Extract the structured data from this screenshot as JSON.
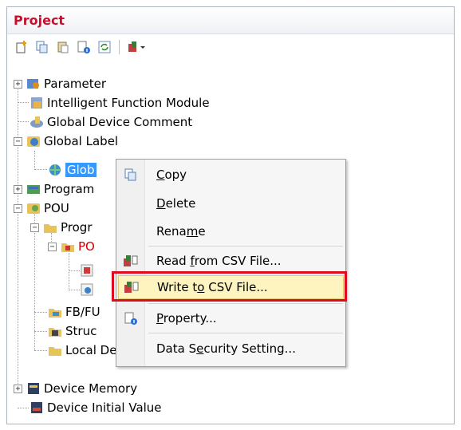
{
  "panel": {
    "title": "Project"
  },
  "toolbar": {
    "buttons": [
      "new-icon",
      "copy-icon",
      "paste-icon",
      "property-icon",
      "refresh-icon",
      "settings-dropdown-icon"
    ]
  },
  "tree": {
    "items": [
      {
        "label": "Parameter",
        "expander": "+"
      },
      {
        "label": "Intelligent Function Module"
      },
      {
        "label": "Global Device Comment"
      },
      {
        "label": "Global Label",
        "expander": "−"
      },
      {
        "label": "Glob",
        "selected": true
      },
      {
        "label": "Program",
        "expander": "+"
      },
      {
        "label": "POU",
        "expander": "−"
      },
      {
        "label": "Progr",
        "expander": "−"
      },
      {
        "label": "PO",
        "expander": "−",
        "red": true
      },
      {
        "label": "FB/FU"
      },
      {
        "label": "Struc"
      },
      {
        "label": "Local Device Comment"
      },
      {
        "label": "Device Memory",
        "expander": "+"
      },
      {
        "label": "Device Initial Value"
      }
    ]
  },
  "context_menu": {
    "items": [
      {
        "label": "Copy",
        "mnemonic": "C",
        "icon": "copy-icon"
      },
      {
        "label": "Delete",
        "mnemonic": "D"
      },
      {
        "label": "Rename",
        "mnemonic": "m"
      },
      {
        "label": "Read from CSV File...",
        "mnemonic": "f",
        "icon": "read-csv-icon"
      },
      {
        "label": "Write to CSV File...",
        "mnemonic": "o",
        "icon": "write-csv-icon",
        "highlighted": true
      },
      {
        "label": "Property...",
        "mnemonic": "P",
        "icon": "property-icon"
      },
      {
        "label": "Data Security Setting...",
        "mnemonic": "e"
      }
    ]
  },
  "colors": {
    "title": "#c8102e",
    "selection": "#3399ff",
    "highlight_box": "#e00a1e",
    "menu_hover": "#fdf4bf"
  }
}
